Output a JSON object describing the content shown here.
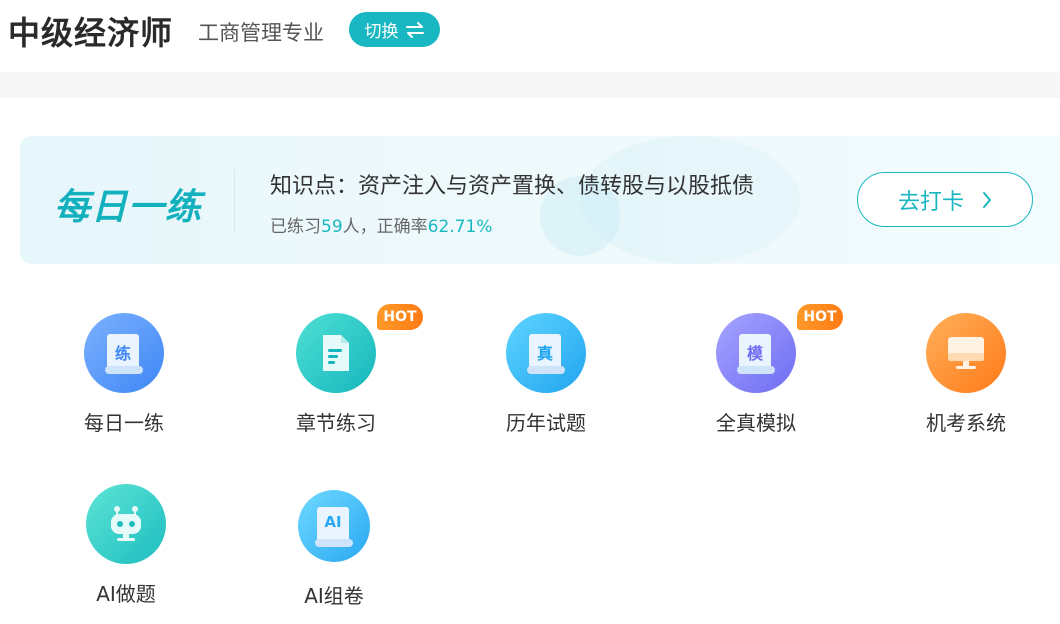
{
  "header": {
    "title": "中级经济师",
    "subtitle": "工商管理专业",
    "switch_label": "切换"
  },
  "daily": {
    "logo_text": "每日一练",
    "knowledge_point": "知识点：资产注入与资产置换、债转股与以股抵债",
    "stats_prefix": "已练习",
    "stats_count": "59",
    "stats_mid": "人，正确率",
    "stats_rate": "62.71%",
    "checkin_label": "去打卡"
  },
  "grid": [
    {
      "label": "每日一练",
      "glyph": "练",
      "hot": false
    },
    {
      "label": "章节练习",
      "glyph": "",
      "hot": true,
      "hot_label": "HOT"
    },
    {
      "label": "历年试题",
      "glyph": "真",
      "hot": false
    },
    {
      "label": "全真模拟",
      "glyph": "模",
      "hot": true,
      "hot_label": "HOT"
    },
    {
      "label": "机考系统",
      "glyph": "",
      "hot": false
    },
    {
      "label": "AI做题",
      "glyph": "",
      "hot": false
    },
    {
      "label": "AI组卷",
      "glyph": "AI",
      "hot": false
    }
  ],
  "colors": {
    "accent": "#19b7c1",
    "hot": "#ff8a1e"
  }
}
